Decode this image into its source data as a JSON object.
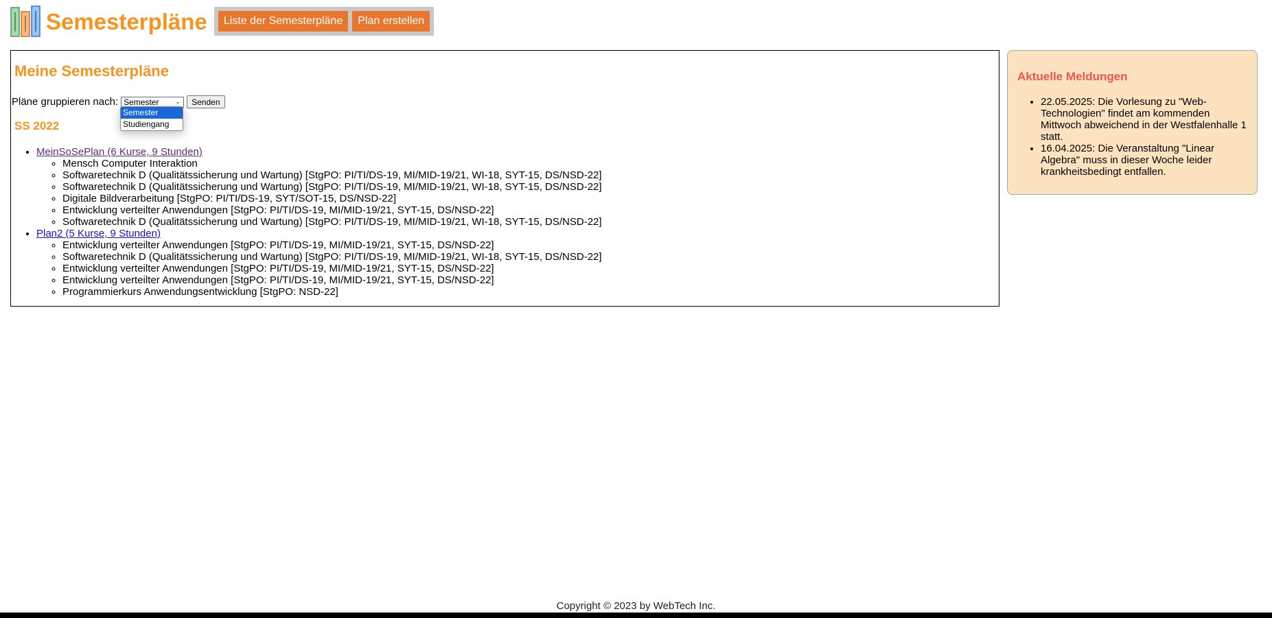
{
  "header": {
    "title": "Semesterpläne",
    "nav": [
      "Liste der Semesterpläne",
      "Plan erstellen"
    ]
  },
  "main": {
    "heading": "Meine Semesterpläne",
    "group_label": "Pläne gruppieren nach:",
    "select_value": "Semester",
    "select_options": [
      "Semester",
      "Studiengang"
    ],
    "send_label": "Senden",
    "semester": "SS 2022",
    "plans": [
      {
        "title": "MeinSoSePlan (6 Kurse, 9 Stunden)",
        "courses": [
          "Mensch Computer Interaktion",
          "Softwaretechnik D (Qualitätssicherung und Wartung) [StgPO: PI/TI/DS-19, MI/MID-19/21, WI-18, SYT-15, DS/NSD-22]",
          "Softwaretechnik D (Qualitätssicherung und Wartung) [StgPO: PI/TI/DS-19, MI/MID-19/21, WI-18, SYT-15, DS/NSD-22]",
          "Digitale Bildverarbeitung [StgPO: PI/TI/DS-19, SYT/SOT-15, DS/NSD-22]",
          "Entwicklung verteilter Anwendungen [StgPO: PI/TI/DS-19, MI/MID-19/21, SYT-15, DS/NSD-22]",
          "Softwaretechnik D (Qualitätssicherung und Wartung) [StgPO: PI/TI/DS-19, MI/MID-19/21, WI-18, SYT-15, DS/NSD-22]"
        ]
      },
      {
        "title": "Plan2 (5 Kurse, 9 Stunden)",
        "courses": [
          "Entwicklung verteilter Anwendungen [StgPO: PI/TI/DS-19, MI/MID-19/21, SYT-15, DS/NSD-22]",
          "Softwaretechnik D (Qualitätssicherung und Wartung) [StgPO: PI/TI/DS-19, MI/MID-19/21, WI-18, SYT-15, DS/NSD-22]",
          "Entwicklung verteilter Anwendungen [StgPO: PI/TI/DS-19, MI/MID-19/21, SYT-15, DS/NSD-22]",
          "Entwicklung verteilter Anwendungen [StgPO: PI/TI/DS-19, MI/MID-19/21, SYT-15, DS/NSD-22]",
          "Programmierkurs Anwendungsentwicklung [StgPO: NSD-22]"
        ]
      }
    ]
  },
  "news": {
    "heading": "Aktuelle Meldungen",
    "items": [
      "22.05.2025: Die Vorlesung zu \"Web-Technologien\" findet am kommenden Mittwoch abweichend in der Westfalenhalle 1 statt.",
      "16.04.2025: Die Veranstaltung \"Linear Algebra\" muss in dieser Woche leider krankheitsbedingt entfallen."
    ]
  },
  "footer": "Copyright © 2023 by WebTech Inc.",
  "colors": {
    "accent": "#f7941d",
    "nav_button": "#e8762d",
    "news_bg": "#fde2c0",
    "news_heading": "#f1554e"
  }
}
